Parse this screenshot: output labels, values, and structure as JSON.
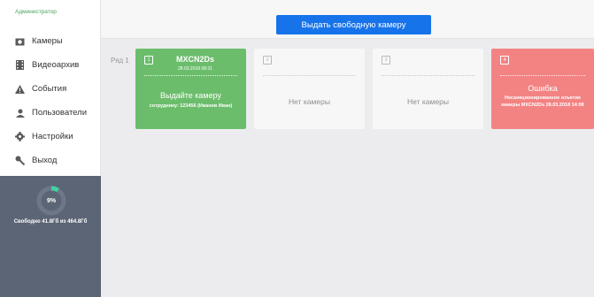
{
  "sidebar": {
    "role": "Администратор",
    "menu": [
      {
        "label": "Камеры",
        "icon": "camera-icon"
      },
      {
        "label": "Видеоархив",
        "icon": "film-icon"
      },
      {
        "label": "События",
        "icon": "warning-icon"
      },
      {
        "label": "Пользователи",
        "icon": "user-icon"
      },
      {
        "label": "Настройки",
        "icon": "gear-icon"
      },
      {
        "label": "Выход",
        "icon": "key-icon"
      }
    ],
    "disk": {
      "percent_label": "9%",
      "used_fraction": 0.09,
      "free_text": "Свободно 41.8Гб из 464.8Гб"
    }
  },
  "header": {
    "issue_button": "Выдать свободную камеру"
  },
  "row": {
    "label": "Ряд 1",
    "slots": [
      {
        "number": "1",
        "camera": "MXCN2Ds",
        "date": "28.03.2018 08:31",
        "title": "Выдайте камеру",
        "detail": "сотруднику: 123456 (Иванов Иван)"
      },
      {
        "number": "2",
        "empty": "Нет камеры"
      },
      {
        "number": "3",
        "empty": "Нет камеры"
      },
      {
        "number": "4",
        "title": "Ошибка",
        "detail": "Несанкционированное изъятие камеры MXCN2Ds 28.03.2018 14:08"
      }
    ]
  },
  "colors": {
    "accent": "#1773ea",
    "ok": "#6bbd6b",
    "error": "#f38383",
    "sidebar": "#5c6576",
    "gauge": "#3fd3a2"
  }
}
